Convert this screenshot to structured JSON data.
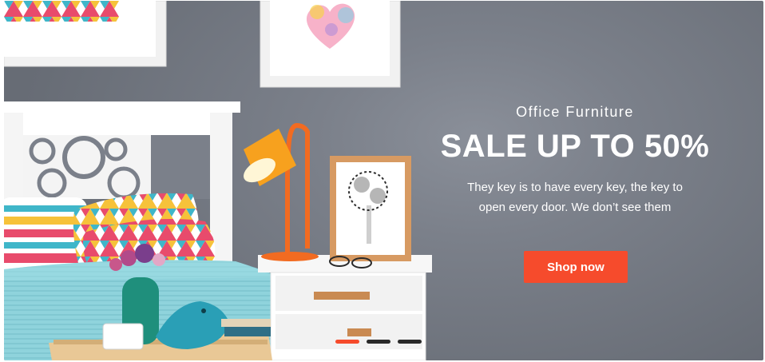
{
  "slider": {
    "eyebrow": "Office Furniture",
    "headline": "SALE UP TO 50%",
    "description": "They key is to have every key, the key to open every door. We don’t see them",
    "cta_label": "Shop now",
    "slide_count": 3,
    "active_slide": 1
  },
  "colors": {
    "accent": "#f64b2c",
    "wall": "#7b808a",
    "dot_inactive": "#2a2a2a",
    "text": "#ffffff"
  }
}
